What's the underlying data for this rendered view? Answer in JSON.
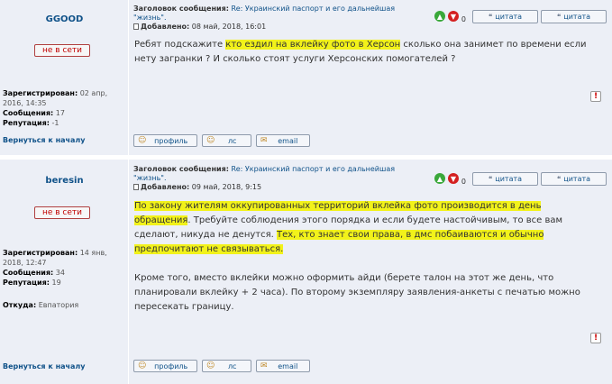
{
  "common": {
    "subject_label": "Заголовок сообщения:",
    "subject_value": "Re: Украинский паспорт и его дальнейшая \"жизнь\".",
    "added_label": "Добавлено:",
    "registered_label": "Зарегистрирован:",
    "messages_label": "Сообщения:",
    "reputation_label": "Репутация:",
    "from_label": "Откуда:",
    "back_to_top": "Вернуться к началу",
    "offline_badge": "не в сети",
    "quote_label": "цитата",
    "profile_label": "профиль",
    "pm_label": "лс",
    "email_label": "email",
    "vote_count": "0",
    "report_icon_text": "!",
    "highlight_color": "#f2f21a",
    "accent_color": "#105289"
  },
  "posts": [
    {
      "author": "GGOOD",
      "registered": "02 апр, 2016, 14:35",
      "messages": "17",
      "reputation": "-1",
      "from": "",
      "added": "08 май, 2018, 16:01",
      "body": {
        "p1_a": "Ребят подскажите ",
        "p1_hl": "кто ездил на вклейку фото в Херсон",
        "p1_b": " сколько она занимет по времени если нету загранки ? И сколько стоят услуги Херсонских помогателей ?"
      }
    },
    {
      "author": "beresin",
      "registered": "14 янв, 2018, 12:47",
      "messages": "34",
      "reputation": "19",
      "from": "Евпатория",
      "added": "09 май, 2018, 9:15",
      "body": {
        "p1_hl1": "По закону жителям оккупированных территорий вклейка фото производится в день обращения",
        "p1_a": ". Требуйте соблюдения этого порядка и если будете настойчивым, то все вам сделают, никуда не денутся. ",
        "p1_hl2": "Тех, кто знает свои права, в дмс побаиваются и обычно предпочитают не связываться.",
        "p2": "Кроме того, вместо вклейки можно оформить айди (берете талон на этот же день, что планировали вклейку + 2 часа). По второму экземпляру заявления-анкеты с печатью можно пересекать границу."
      }
    }
  ]
}
